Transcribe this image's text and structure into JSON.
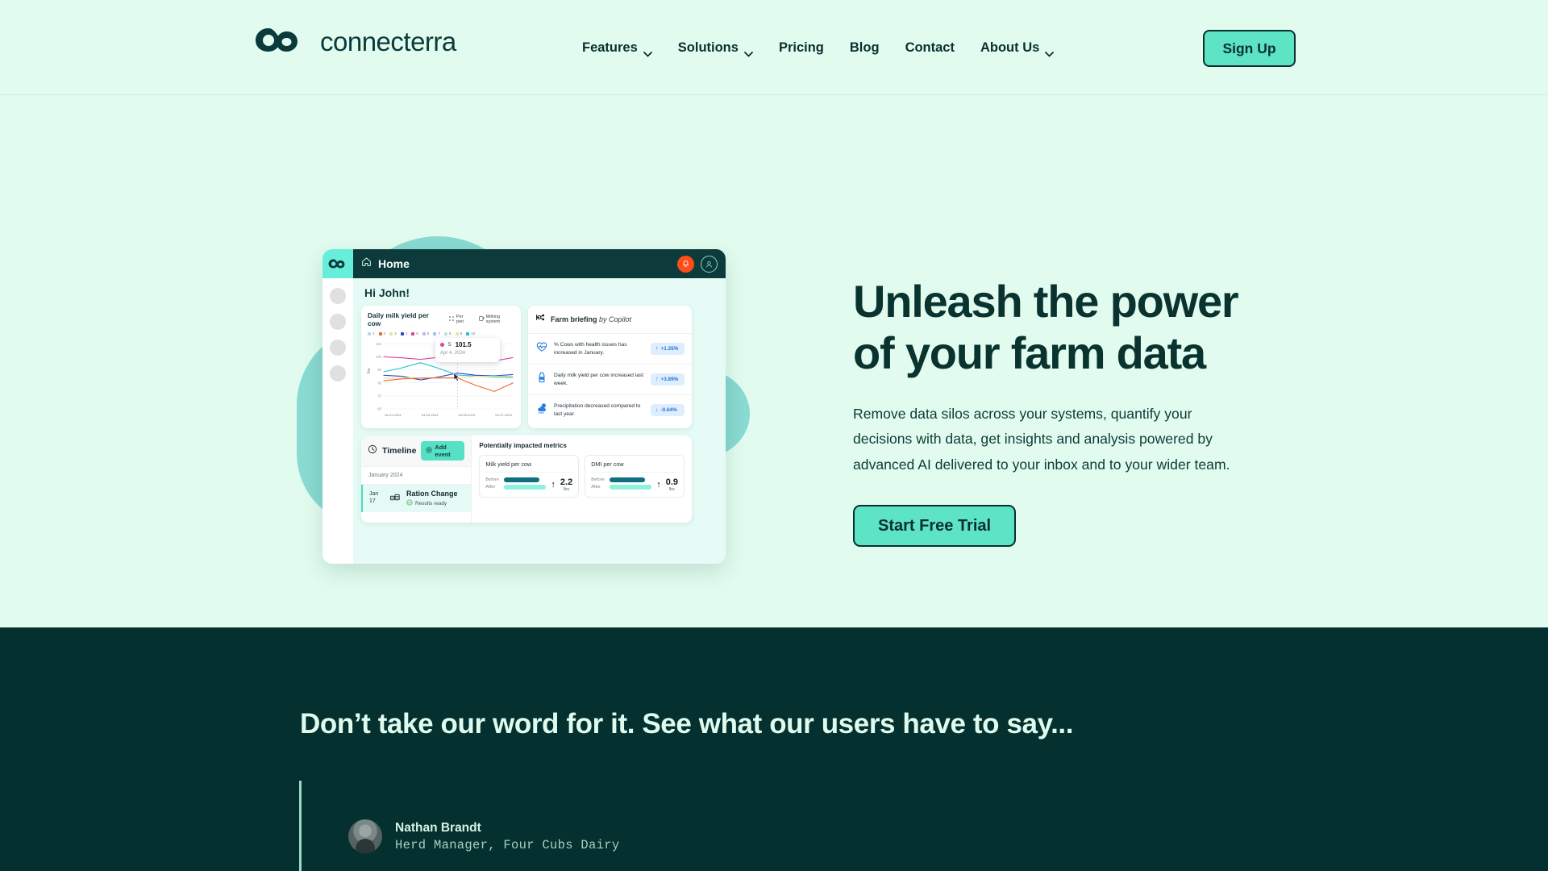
{
  "colors": {
    "page_bg": "#e1fcef",
    "dark_section_bg": "#04302f",
    "accent_mint": "#5ce4c4",
    "ink": "#0b2f2f",
    "heading": "#0a3330"
  },
  "header": {
    "brand_name": "connecterra",
    "brand_logo_icon": "connecterra-cloud-logo-icon",
    "nav": [
      {
        "label": "Features",
        "has_dropdown": true,
        "icon": "chevron-down-icon"
      },
      {
        "label": "Solutions",
        "has_dropdown": true,
        "icon": "chevron-down-icon"
      },
      {
        "label": "Pricing",
        "has_dropdown": false,
        "icon": ""
      },
      {
        "label": "Blog",
        "has_dropdown": false,
        "icon": ""
      },
      {
        "label": "Contact",
        "has_dropdown": false,
        "icon": ""
      },
      {
        "label": "About Us",
        "has_dropdown": true,
        "icon": "chevron-down-icon"
      }
    ],
    "signup_label": "Sign Up"
  },
  "hero": {
    "heading_line1": "Unleash the power",
    "heading_line2": "of your farm data",
    "paragraph": "Remove data silos across your systems, quantify your decisions with data, get insights and analysis powered by advanced AI delivered to your inbox and to your wider team.",
    "cta_label": "Start Free Trial"
  },
  "dashboard": {
    "topbar": {
      "home_label": "Home",
      "home_icon": "house-icon",
      "bell_icon": "bell-icon",
      "avatar_icon": "user-avatar-icon",
      "logo_icon": "connecterra-cloud-logo-icon"
    },
    "greeting": "Hi John!",
    "chart_card": {
      "title": "Daily milk yield per cow",
      "control_per_pen": "Per pen",
      "control_per_pen_icon": "grid-dots-icon",
      "control_milking": "Milking system",
      "control_milking_icon": "milking-system-icon",
      "y_axis_label": "lbs",
      "tooltip": {
        "series": "5",
        "value": "101.5",
        "date": "Apr 4, 2024",
        "dot_color": "#e0409a"
      }
    },
    "brief_card": {
      "title": "Farm briefing",
      "title_suffix": "by Copilot",
      "title_icon": "copilot-icon",
      "rows": [
        {
          "icon": "heartbeat-icon",
          "text": "% Cows with health issues has increased in January.",
          "delta": "+1.35%",
          "direction": "up",
          "arrow": "↑"
        },
        {
          "icon": "milk-bottle-icon",
          "text": "Daily milk yield per cow increased last week.",
          "delta": "+3.89%",
          "direction": "up",
          "arrow": "↑"
        },
        {
          "icon": "precipitation-icon",
          "text": "Precipitation decreased compared to last year.",
          "delta": "-0.64%",
          "direction": "down",
          "arrow": "↓"
        }
      ]
    },
    "timeline_card": {
      "title": "Timeline",
      "title_icon": "clock-icon",
      "add_event_label": "Add event",
      "add_event_icon": "plus-circle-icon",
      "month": "January 2024",
      "event": {
        "day_month": "Jan",
        "day_number": "17",
        "icon": "feed-ration-icon",
        "name": "Ration Change",
        "status": "Results ready",
        "status_icon": "check-circle-icon"
      }
    },
    "metrics_card": {
      "title": "Potentially impacted metrics",
      "items": [
        {
          "name": "Milk yield per cow",
          "before_label": "Before",
          "after_label": "After",
          "value": "2.2",
          "unit": "lbs",
          "arrow": "↑"
        },
        {
          "name": "DMI per cow",
          "before_label": "Before",
          "after_label": "After",
          "value": "0.9",
          "unit": "lbs",
          "arrow": "↑"
        }
      ]
    }
  },
  "chart_data": {
    "type": "line",
    "title": "Daily milk yield per cow",
    "xlabel": "",
    "ylabel": "lbs",
    "ylim": [
      60,
      112
    ],
    "yticks": [
      60,
      70,
      80,
      90,
      100,
      110
    ],
    "x": [
      "04-01-2024",
      "04-02-2024",
      "04-03-2024",
      "04-04-2024",
      "04-05-2024",
      "04-06-2024",
      "04-07-2024"
    ],
    "xticks": [
      "04-01-2024",
      "04-03-2024",
      "04-05-2024",
      "04-07-2024"
    ],
    "grid": true,
    "legend": {
      "position": "top",
      "entries": [
        {
          "label": "1",
          "color": "#bcd4f2"
        },
        {
          "label": "2",
          "color": "#f2662a"
        },
        {
          "label": "3",
          "color": "#ecdf9a"
        },
        {
          "label": "4",
          "color": "#2f48c4"
        },
        {
          "label": "5",
          "color": "#e0409a"
        },
        {
          "label": "6",
          "color": "#b6bde8"
        },
        {
          "label": "7",
          "color": "#9fc2e8"
        },
        {
          "label": "8",
          "color": "#bfe5e0"
        },
        {
          "label": "9",
          "color": "#ece7a0"
        },
        {
          "label": "10",
          "color": "#17c4d6"
        }
      ]
    },
    "annotation": {
      "x": "04-04-2024",
      "series": "5",
      "value": 101.5,
      "date": "Apr 4, 2024"
    },
    "series": [
      {
        "name": "5",
        "color": "#e0409a",
        "values": [
          100.0,
          99.2,
          98.0,
          99.6,
          101.5,
          99.0,
          96.8,
          99.4
        ]
      },
      {
        "name": "10",
        "color": "#17c4d6",
        "values": [
          88.5,
          91.6,
          95.5,
          91.0,
          86.0,
          85.2,
          84.5,
          84.2
        ]
      },
      {
        "name": "4",
        "color": "#2f48c4",
        "values": [
          85.8,
          85.0,
          82.2,
          84.6,
          87.5,
          85.8,
          85.4,
          86.4
        ]
      },
      {
        "name": "3",
        "color": "#ecdf9a",
        "values": [
          83.6,
          83.8,
          83.9,
          83.9,
          84.0,
          85.0,
          85.0,
          85.0
        ]
      },
      {
        "name": "2",
        "color": "#f2662a",
        "values": [
          81.6,
          83.0,
          83.6,
          83.7,
          83.8,
          78.0,
          73.4,
          79.8
        ]
      }
    ]
  },
  "testimonials": {
    "heading": "Don’t take our word for it. See what our users have to say...",
    "author_name": "Nathan Brandt",
    "author_role": "Herd Manager, Four Cubs Dairy",
    "avatar_icon": "person-photo-avatar"
  }
}
